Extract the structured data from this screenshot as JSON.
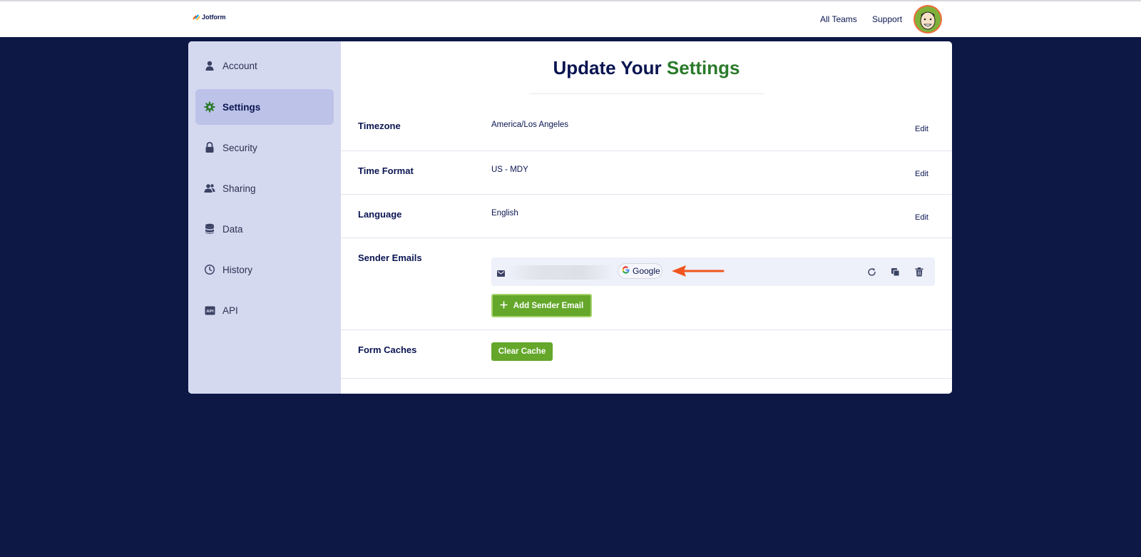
{
  "header": {
    "logo_text": "Jotform",
    "nav": [
      {
        "label": "All Teams"
      },
      {
        "label": "Support"
      }
    ]
  },
  "sidebar": {
    "items": [
      {
        "label": "Account",
        "icon": "user-icon"
      },
      {
        "label": "Settings",
        "icon": "gear-icon",
        "active": true
      },
      {
        "label": "Security",
        "icon": "lock-icon"
      },
      {
        "label": "Sharing",
        "icon": "users-icon"
      },
      {
        "label": "Data",
        "icon": "database-icon"
      },
      {
        "label": "History",
        "icon": "history-icon"
      },
      {
        "label": "API",
        "icon": "api-icon"
      }
    ]
  },
  "main": {
    "title_part1": "Update Your",
    "title_part2": "Settings",
    "settings": {
      "timezone": {
        "label": "Timezone",
        "value": "America/Los Angeles",
        "action": "Edit"
      },
      "time_format": {
        "label": "Time Format",
        "value": "US - MDY",
        "action": "Edit"
      },
      "language": {
        "label": "Language",
        "value": "English",
        "action": "Edit"
      },
      "sender_emails": {
        "label": "Sender Emails",
        "provider": "Google",
        "add_label": "Add Sender Email"
      },
      "form_caches": {
        "label": "Form Caches",
        "button": "Clear Cache"
      }
    }
  },
  "colors": {
    "background": "#0d1845",
    "accent_green": "#2b7a2b",
    "button_green": "#64a72a",
    "sidebar": "#d5d9f0",
    "sidebar_active": "#bcc2e8",
    "annotation_arrow": "#f0551f"
  }
}
